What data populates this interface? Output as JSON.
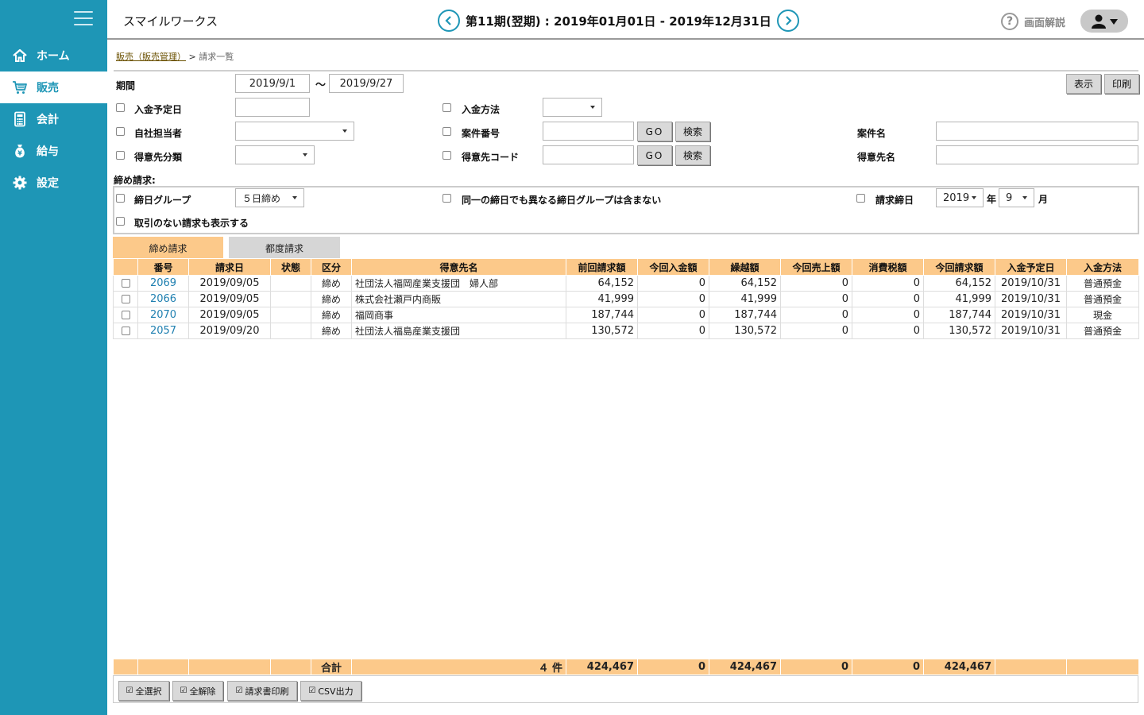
{
  "header": {
    "app_title": "スマイルワークス",
    "period": "第11期(翌期) : 2019年01月01日 - 2019年12月31日",
    "help_label": "画面解説"
  },
  "sidebar": {
    "items": [
      {
        "label": "ホーム",
        "icon": "home-icon"
      },
      {
        "label": "販売",
        "icon": "cart-icon",
        "active": true
      },
      {
        "label": "会計",
        "icon": "calculator-icon"
      },
      {
        "label": "給与",
        "icon": "money-bag-icon"
      },
      {
        "label": "設定",
        "icon": "gear-icon"
      }
    ]
  },
  "breadcrumb": {
    "parent": "販売（販売管理）",
    "sep": ">",
    "current": "請求一覧"
  },
  "filters": {
    "period_label": "期間",
    "period_from": "2019/9/1",
    "tilde": "〜",
    "period_to": "2019/9/27",
    "show_button": "表示",
    "print_button": "印刷",
    "payment_due_label": "入金予定日",
    "payment_method_label": "入金方法",
    "staff_label": "自社担当者",
    "case_number_label": "案件番号",
    "case_name_label": "案件名",
    "customer_class_label": "得意先分類",
    "customer_code_label": "得意先コード",
    "customer_name_label": "得意先名",
    "go_label": "GO",
    "search_label": "検索"
  },
  "closing": {
    "section_label": "締め請求:",
    "group_label": "締日グループ",
    "group_value": "５日締め",
    "exclude_label": "同一の締日でも異なる締日グループは含まない",
    "closing_date_label": "請求締日",
    "year_value": "2019",
    "year_unit": "年",
    "month_value": "9",
    "month_unit": "月",
    "show_no_tx_label": "取引のない請求も表示する"
  },
  "tabs": [
    {
      "label": "締め請求",
      "active": true
    },
    {
      "label": "都度請求",
      "active": false
    }
  ],
  "table": {
    "headers": [
      "",
      "番号",
      "請求日",
      "状態",
      "区分",
      "得意先名",
      "前回請求額",
      "今回入金額",
      "繰越額",
      "今回売上額",
      "消費税額",
      "今回請求額",
      "入金予定日",
      "入金方法"
    ],
    "rows": [
      {
        "no": "2069",
        "date": "2019/09/05",
        "status": "",
        "type": "締め",
        "customer": "社団法人福岡産業支援団　婦人部",
        "prev": "64,152",
        "paid": "0",
        "carry": "64,152",
        "sales": "0",
        "tax": "0",
        "total": "64,152",
        "due": "2019/10/31",
        "method": "普通預金"
      },
      {
        "no": "2066",
        "date": "2019/09/05",
        "status": "",
        "type": "締め",
        "customer": "株式会社瀬戸内商販",
        "prev": "41,999",
        "paid": "0",
        "carry": "41,999",
        "sales": "0",
        "tax": "0",
        "total": "41,999",
        "due": "2019/10/31",
        "method": "普通預金"
      },
      {
        "no": "2070",
        "date": "2019/09/05",
        "status": "",
        "type": "締め",
        "customer": "福岡商事",
        "prev": "187,744",
        "paid": "0",
        "carry": "187,744",
        "sales": "0",
        "tax": "0",
        "total": "187,744",
        "due": "2019/10/31",
        "method": "現金"
      },
      {
        "no": "2057",
        "date": "2019/09/20",
        "status": "",
        "type": "締め",
        "customer": "社団法人福島産業支援団",
        "prev": "130,572",
        "paid": "0",
        "carry": "130,572",
        "sales": "0",
        "tax": "0",
        "total": "130,572",
        "due": "2019/10/31",
        "method": "普通預金"
      }
    ]
  },
  "totals": {
    "label": "合計",
    "count": "４ 件",
    "prev": "424,467",
    "paid": "0",
    "carry": "424,467",
    "sales": "0",
    "tax": "0",
    "total": "424,467"
  },
  "footer": {
    "select_all": "全選択",
    "deselect_all": "全解除",
    "print_invoice": "請求書印刷",
    "csv_export": "CSV出力"
  },
  "colors": {
    "sidebar": "#1e96b6",
    "table_header": "#fcc98a",
    "link": "#1e7fb0"
  }
}
